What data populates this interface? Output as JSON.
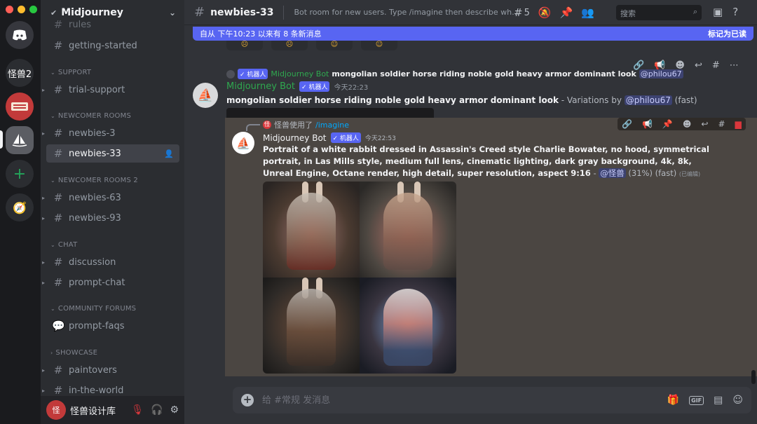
{
  "colors": {
    "brand": "#5865f2",
    "bot_badge": "#5865f2",
    "username_green": "#2fa84f",
    "mention_bg": "#3c4270",
    "danger": "#da373c"
  },
  "rail": {
    "servers": [
      "怪兽2",
      "Midjourney"
    ]
  },
  "sidebar": {
    "server_name": "Midjourney",
    "items": [
      {
        "type": "channel",
        "label": "rules"
      },
      {
        "type": "channel",
        "label": "getting-started"
      },
      {
        "type": "category",
        "label": "SUPPORT"
      },
      {
        "type": "channel",
        "label": "trial-support"
      },
      {
        "type": "category",
        "label": "NEWCOMER ROOMS"
      },
      {
        "type": "channel",
        "label": "newbies-3"
      },
      {
        "type": "channel",
        "label": "newbies-33",
        "active": true
      },
      {
        "type": "category",
        "label": "NEWCOMER ROOMS 2"
      },
      {
        "type": "channel",
        "label": "newbies-63"
      },
      {
        "type": "channel",
        "label": "newbies-93"
      },
      {
        "type": "category",
        "label": "CHAT"
      },
      {
        "type": "channel",
        "label": "discussion"
      },
      {
        "type": "channel",
        "label": "prompt-chat"
      },
      {
        "type": "category",
        "label": "COMMUNITY FORUMS"
      },
      {
        "type": "channel",
        "label": "prompt-faqs"
      },
      {
        "type": "category",
        "label": "SHOWCASE"
      },
      {
        "type": "channel",
        "label": "paintovers"
      },
      {
        "type": "channel",
        "label": "in-the-world"
      }
    ],
    "user": {
      "name": "怪兽设计库"
    }
  },
  "header": {
    "channel": "newbies-33",
    "topic": "Bot room for new users. Type /imagine then describe what you...",
    "threads_count": "5",
    "search_placeholder": "搜索"
  },
  "banner": {
    "text": "自从 下午10:23 以来有 8 条新消息",
    "action": "标记为已读"
  },
  "reply1": {
    "badge": "✓ 机器人",
    "name": "Midjourney Bot",
    "text": "mongolian soldier horse riding noble gold heavy armor dominant look",
    "mention": "@philou67"
  },
  "message1": {
    "author": "Midjourney Bot",
    "badge": "✓ 机器人",
    "timestamp": "今天22:23",
    "prompt": "mongolian soldier horse riding noble gold heavy armor dominant look",
    "suffix": " - Variations by ",
    "mention": "@philou67",
    "mode": " (fast)"
  },
  "message2": {
    "reply_user": "怪兽使用了",
    "reply_cmd": "/imagine",
    "author": "Midjourney Bot",
    "badge": "✓ 机器人",
    "timestamp": "今天22:53",
    "prompt": "Portrait of a white rabbit dressed in Assassin's Creed style Charlie Bowater, no hood, symmetrical portrait, in Las Mills style, medium full lens, cinematic lighting, dark gray background, 4k, 8k, Unreal Engine, Octane render, high detail, super resolution, aspect 9:16",
    "sep": " - ",
    "mention": "@怪兽",
    "status": " (31%) (fast) ",
    "edited": "(已编辑)"
  },
  "composer": {
    "placeholder": "给 #常规 发消息"
  },
  "icons": [
    "discord-logo",
    "thread-icon",
    "mute-icon",
    "pin-icon",
    "members-icon",
    "search-icon",
    "inbox-icon",
    "help-icon",
    "gift-icon",
    "gif-icon",
    "sticker-icon",
    "emoji-icon",
    "mic-muted-icon",
    "headphones-icon",
    "settings-icon"
  ]
}
